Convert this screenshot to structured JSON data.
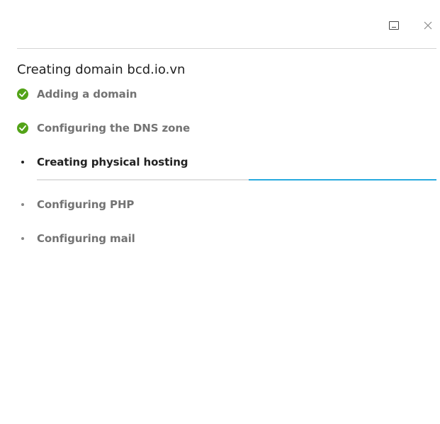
{
  "window": {
    "minimize_icon": "minimize-icon",
    "close_icon": "close-icon"
  },
  "title": "Creating domain bcd.io.vn",
  "steps": [
    {
      "label": "Adding a domain",
      "status": "done"
    },
    {
      "label": "Configuring the DNS zone",
      "status": "done"
    },
    {
      "label": "Creating physical hosting",
      "status": "in-progress"
    },
    {
      "label": "Configuring PHP",
      "status": "pending"
    },
    {
      "label": "Configuring mail",
      "status": "pending"
    }
  ],
  "progress": {
    "state": "indeterminate",
    "segment_start_fraction": 0.53,
    "segment_end_fraction": 1.0
  },
  "colors": {
    "done": "#53a318",
    "progress": "#28aade",
    "track": "#e0e0e0",
    "pending_text": "#737373",
    "active_text": "#222222"
  }
}
